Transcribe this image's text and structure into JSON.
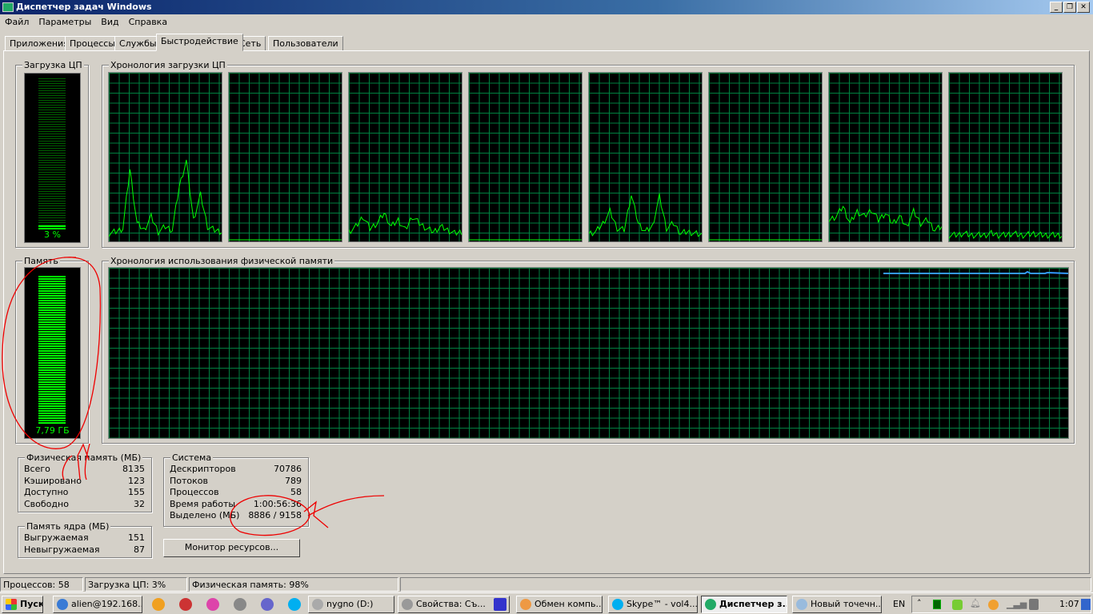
{
  "window": {
    "title": "Диспетчер задач Windows",
    "min": "_",
    "max": "❐",
    "close": "✕"
  },
  "menu": [
    "Файл",
    "Параметры",
    "Вид",
    "Справка"
  ],
  "tabs": [
    "Приложения",
    "Процессы",
    "Службы",
    "Быстродействие",
    "Сеть",
    "Пользователи"
  ],
  "active_tab": "Быстродействие",
  "cpu": {
    "label": "Загрузка ЦП",
    "value": "3 %",
    "percent": 3,
    "history_label": "Хронология загрузки ЦП",
    "cores": [
      [
        2,
        3,
        5,
        40,
        8,
        4,
        12,
        3,
        6,
        4,
        30,
        45,
        10,
        25,
        6,
        4,
        3
      ],
      [
        0,
        0,
        0,
        0,
        0,
        0,
        0,
        0,
        0,
        0,
        0,
        0,
        0,
        0,
        0,
        0,
        0
      ],
      [
        3,
        6,
        12,
        5,
        8,
        14,
        6,
        10,
        4,
        12,
        8,
        5,
        3,
        6,
        4,
        2,
        3
      ],
      [
        0,
        0,
        0,
        0,
        0,
        0,
        0,
        0,
        0,
        0,
        0,
        0,
        0,
        0,
        0,
        0,
        0
      ],
      [
        2,
        3,
        8,
        15,
        5,
        4,
        25,
        8,
        3,
        6,
        24,
        5,
        8,
        2,
        3,
        2,
        1
      ],
      [
        0,
        0,
        0,
        0,
        0,
        0,
        0,
        0,
        0,
        0,
        0,
        0,
        0,
        0,
        0,
        0,
        0
      ],
      [
        10,
        12,
        18,
        8,
        15,
        12,
        16,
        10,
        14,
        8,
        12,
        6,
        15,
        8,
        10,
        4,
        6
      ],
      [
        1,
        1,
        2,
        1,
        1,
        1,
        2,
        1,
        1,
        2,
        1,
        1,
        2,
        1,
        1,
        1,
        1
      ]
    ]
  },
  "memory": {
    "label": "Память",
    "value": "7,79 ГБ",
    "percent": 98,
    "history_label": "Хронология использования физической памяти",
    "line_color": "#3399ff"
  },
  "physical": {
    "title": "Физическая память (МБ)",
    "rows": [
      {
        "k": "Всего",
        "v": "8135"
      },
      {
        "k": "Кэшировано",
        "v": "123"
      },
      {
        "k": "Доступно",
        "v": "155"
      },
      {
        "k": "Свободно",
        "v": "32"
      }
    ]
  },
  "kernel": {
    "title": "Память ядра (МБ)",
    "rows": [
      {
        "k": "Выгружаемая",
        "v": "151"
      },
      {
        "k": "Невыгружаемая",
        "v": "87"
      }
    ]
  },
  "system": {
    "title": "Система",
    "rows": [
      {
        "k": "Дескрипторов",
        "v": "70786"
      },
      {
        "k": "Потоков",
        "v": "789"
      },
      {
        "k": "Процессов",
        "v": "58"
      },
      {
        "k": "Время работы",
        "v": "1:00:56:36"
      },
      {
        "k": "Выделено (МБ)",
        "v": "8886 / 9158"
      }
    ]
  },
  "resource_monitor_button": "Монитор ресурсов...",
  "status": {
    "processes": "Процессов: 58",
    "cpu": "Загрузка ЦП: 3%",
    "memory": "Физическая память: 98%"
  },
  "taskbar": {
    "start": "Пуск",
    "tasks": [
      {
        "label": "alien@192.168...",
        "color": "#3a7bd5"
      },
      {
        "label": "nygno (D:)",
        "color": "#aaa"
      },
      {
        "label": "Свойства: Съ...",
        "color": "#999"
      },
      {
        "label": "Обмен компь...",
        "color": "#e94"
      },
      {
        "label": "Skype™ - vol4...",
        "color": "#00aff0"
      },
      {
        "label": "Диспетчер з...",
        "color": "#2a6"
      },
      {
        "label": "Новый точечн...",
        "color": "#9bd"
      }
    ],
    "quick": [
      {
        "icon": "counter-2-icon",
        "color": "#f0a020"
      },
      {
        "icon": "ccleaner-icon",
        "color": "#c33"
      },
      {
        "icon": "chart-app-icon",
        "color": "#d4a"
      },
      {
        "icon": "disc-icon",
        "color": "#888"
      },
      {
        "icon": "torrent-icon",
        "color": "#66c"
      },
      {
        "icon": "skype-icon",
        "color": "#00aff0"
      }
    ],
    "lang": "EN",
    "clock": "1:07"
  }
}
